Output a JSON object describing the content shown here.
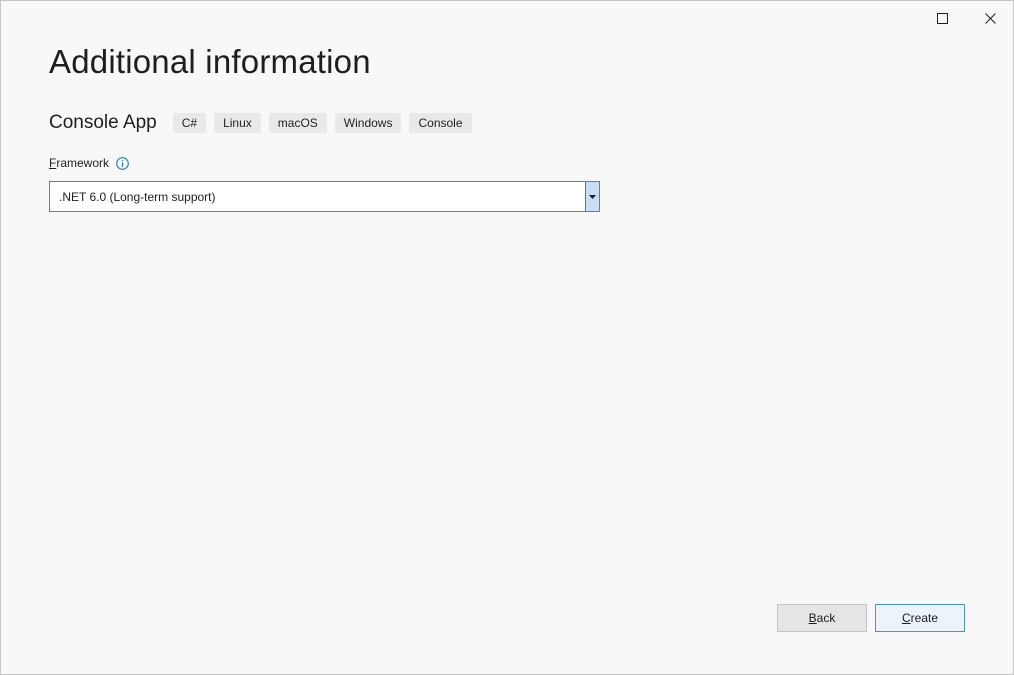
{
  "dialog": {
    "title": "Additional information",
    "project_name": "Console App",
    "tags": [
      "C#",
      "Linux",
      "macOS",
      "Windows",
      "Console"
    ]
  },
  "framework": {
    "label_access_key": "F",
    "label_rest": "ramework",
    "selected_value": ".NET 6.0 (Long-term support)"
  },
  "buttons": {
    "back_access_key": "B",
    "back_rest": "ack",
    "create_access_key": "C",
    "create_rest": "reate"
  },
  "icons": {
    "maximize": "maximize-icon",
    "close": "close-icon",
    "info": "info-icon",
    "dropdown": "chevron-down-icon"
  },
  "colors": {
    "accent": "#2f7dc0",
    "info_icon": "#1a7fc1",
    "primary_button_border": "#4b92d1",
    "dropdown_button": "#c9def5"
  }
}
